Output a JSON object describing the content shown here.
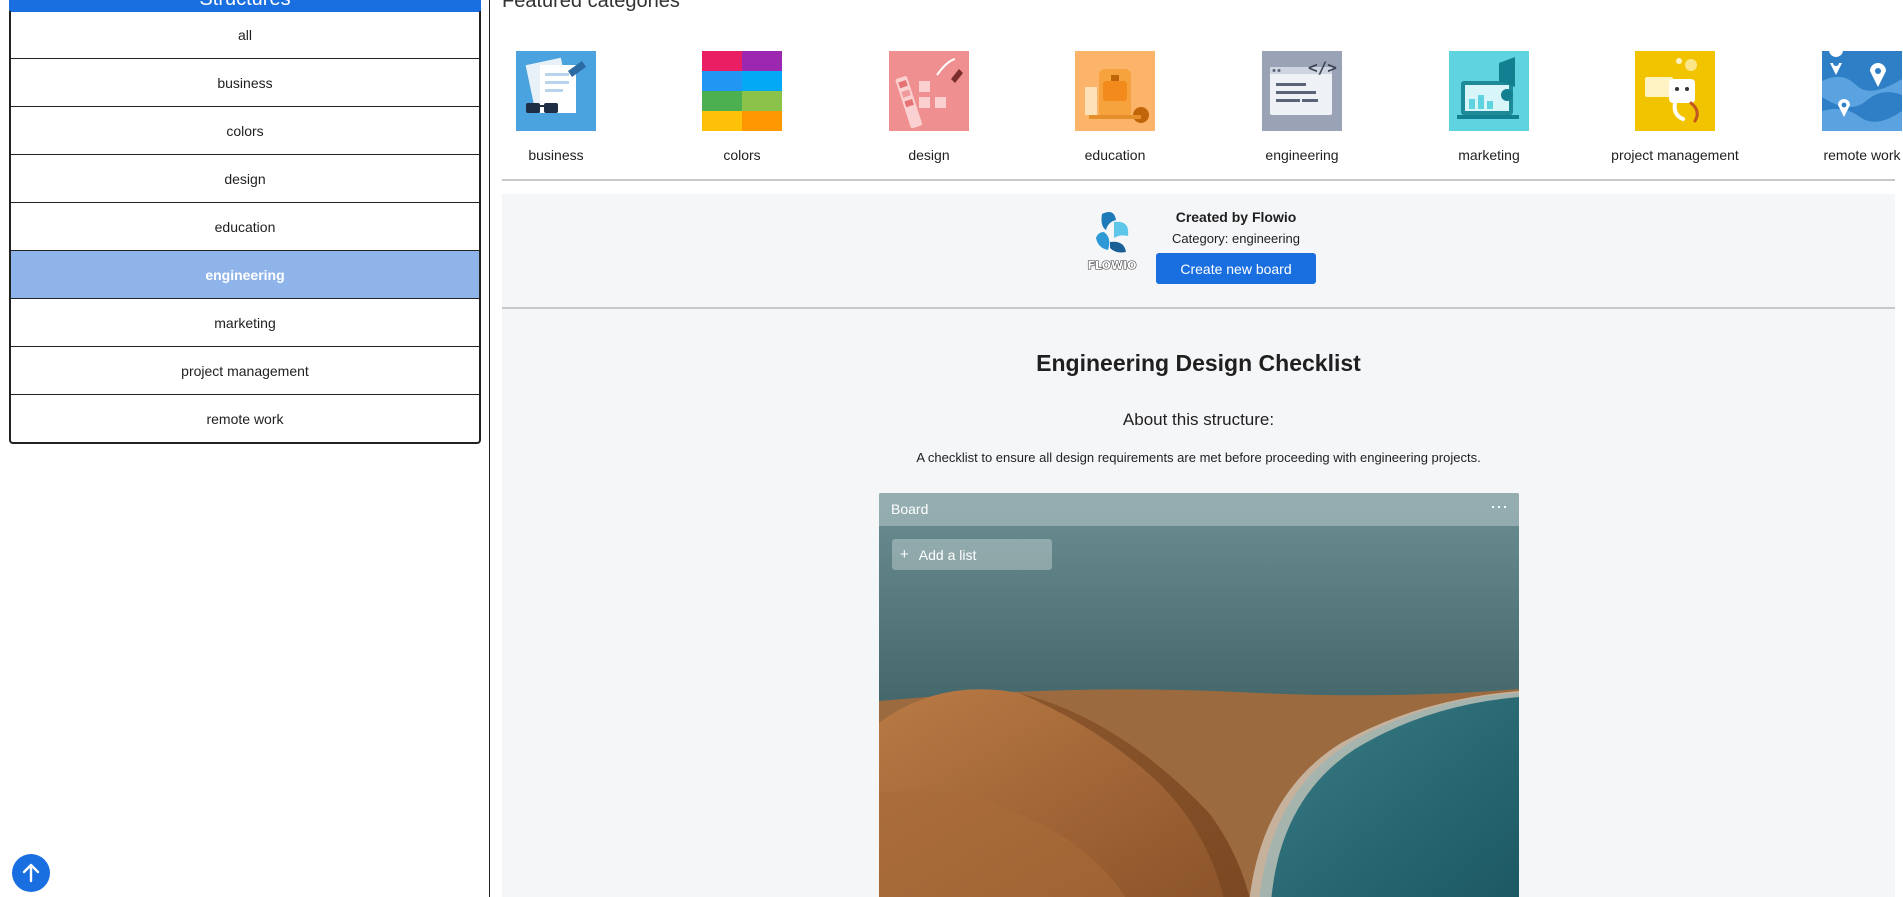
{
  "sidebar": {
    "header": "Structures",
    "categories": [
      {
        "label": "all"
      },
      {
        "label": "business"
      },
      {
        "label": "colors"
      },
      {
        "label": "design"
      },
      {
        "label": "education"
      },
      {
        "label": "engineering",
        "active": true
      },
      {
        "label": "marketing"
      },
      {
        "label": "project management"
      },
      {
        "label": "remote work"
      }
    ]
  },
  "main": {
    "featured_title": "Featured categories",
    "featured": [
      {
        "label": "business",
        "icon": "business-icon",
        "color": "#4aa3df"
      },
      {
        "label": "colors",
        "icon": "colors-icon",
        "color": "#e91e63"
      },
      {
        "label": "design",
        "icon": "design-icon",
        "color": "#f08f8f"
      },
      {
        "label": "education",
        "icon": "education-icon",
        "color": "#fbb46a"
      },
      {
        "label": "engineering",
        "icon": "engineering-icon",
        "color": "#9aa3b5"
      },
      {
        "label": "marketing",
        "icon": "marketing-icon",
        "color": "#5fd3e0"
      },
      {
        "label": "project management",
        "icon": "project-management-icon",
        "color": "#f2c400"
      },
      {
        "label": "remote work",
        "icon": "remote-work-icon",
        "color": "#2f7fc6"
      }
    ],
    "creator": {
      "created_by": "Created by Flowio",
      "category": "Category: engineering",
      "create_button": "Create new board",
      "logo_text": "FLOWIO"
    },
    "structure": {
      "title": "Engineering Design Checklist",
      "about": "About this structure:",
      "description": "A checklist to ensure all design requirements are met before proceeding with engineering projects."
    },
    "board": {
      "name": "Board",
      "menu_icon": "more-horizontal-icon",
      "add_list": "Add a list"
    }
  },
  "colors": {
    "accent": "#1a6fe0",
    "active_item": "#8fb4ea"
  }
}
